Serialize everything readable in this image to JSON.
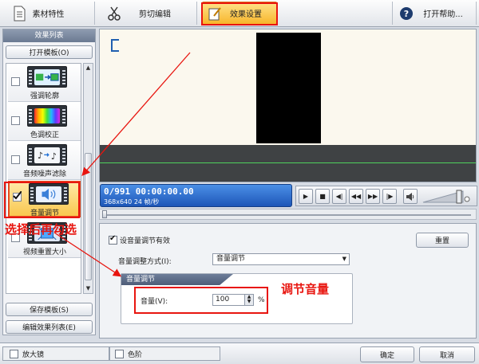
{
  "tabs": [
    {
      "label": "素材特性",
      "icon": "document-icon"
    },
    {
      "label": "剪切编辑",
      "icon": "scissors-icon"
    },
    {
      "label": "效果设置",
      "icon": "effect-edit-icon",
      "active": true
    },
    {
      "label": "打开帮助...",
      "icon": "help-icon"
    }
  ],
  "left_panel": {
    "title": "效果列表",
    "open_template": "打开模板(O)",
    "save_template": "保存模板(S)",
    "edit_list": "编辑效果列表(E)",
    "items": [
      {
        "label": "强调轮廓",
        "checked": false
      },
      {
        "label": "色调校正",
        "checked": false
      },
      {
        "label": "音频噪声滤除",
        "checked": false
      },
      {
        "label": "音量调节",
        "checked": true,
        "selected": true
      },
      {
        "label": "视频重置大小",
        "checked": false
      }
    ]
  },
  "timecode": {
    "main": "0/991  00:00:00.00",
    "sub": "368x640 24 帧/秒"
  },
  "settings": {
    "enable_label": "设音量调节有效",
    "enabled": true,
    "reset_button": "重置",
    "mode_label": "音量调整方式(I):",
    "mode_value": "音量调节",
    "group_title": "音量调节",
    "volume_label": "音量(V):",
    "volume_value": "100",
    "volume_unit": "%"
  },
  "bottom": {
    "magnifier": "放大镜",
    "levels": "色阶",
    "ok": "确定",
    "cancel": "取消"
  },
  "annotations": {
    "select_then_check": "选择后再勾选",
    "adjust_volume": "调节音量"
  },
  "colors": {
    "accent_active_tab": "#f7b52b",
    "annotation_red": "#e8150f",
    "timecode_blue": "#1d56b8"
  }
}
